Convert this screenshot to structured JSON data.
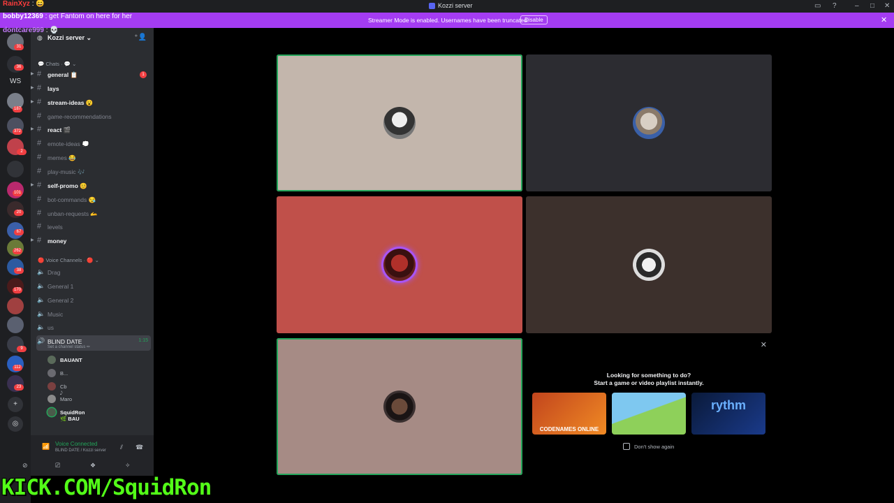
{
  "window": {
    "title": "Kozzi server"
  },
  "banner": {
    "message": "Streamer Mode is enabled. Usernames have been truncated.",
    "disable_label": "Disable"
  },
  "chat_overlay": [
    {
      "name": "RainXyz",
      "message": ": 😄",
      "color": "#ff3d3d"
    },
    {
      "name": "bobby12369",
      "message": ": get Fantom on here for her",
      "color": "#ffffff"
    },
    {
      "name": "dontcare999",
      "message": ": 💀",
      "color": "#c77dff"
    }
  ],
  "server": {
    "name": "Kozzi server"
  },
  "rail": {
    "ws_label": "WS",
    "badges": [
      "31",
      "36",
      "187",
      "372",
      "2",
      "101",
      "20",
      "67",
      "262",
      "38",
      "170",
      "9",
      "112",
      "23"
    ]
  },
  "categories": {
    "chats": "Chats",
    "voice": "Voice Channels"
  },
  "channels": [
    {
      "name": "general 📋",
      "unread": true,
      "arrow": true,
      "badge": "1"
    },
    {
      "name": "lays",
      "unread": true,
      "arrow": true
    },
    {
      "name": "stream-ideas 😮",
      "unread": true,
      "arrow": true
    },
    {
      "name": "game-recommendations",
      "unread": false
    },
    {
      "name": "react 🎬",
      "unread": true,
      "arrow": true
    },
    {
      "name": "emote-ideas 💭",
      "unread": false
    },
    {
      "name": "memes 😂",
      "unread": false
    },
    {
      "name": "play-music 🎶",
      "unread": false
    },
    {
      "name": "self-promo 😊",
      "unread": true,
      "arrow": true
    },
    {
      "name": "bot-commands 😪",
      "unread": false
    },
    {
      "name": "unban-requests 🫴",
      "unread": false
    },
    {
      "name": "levels",
      "unread": false
    },
    {
      "name": "money",
      "unread": true,
      "arrow": true
    }
  ],
  "voice_channels": [
    "Drag",
    "General 1",
    "General 2",
    "Music",
    "us"
  ],
  "active_voice": {
    "name": "BLIND DATE",
    "duration": "1:15",
    "status": "Set a channel status ✏"
  },
  "voice_users": [
    {
      "name": "BAUANT",
      "bold": true,
      "speaking": false
    },
    {
      "name": "B...",
      "bold": false,
      "speaking": false
    },
    {
      "name": "Cb 𝅘𝅥𝅮",
      "bold": false,
      "speaking": false
    },
    {
      "name": "Maro",
      "bold": false,
      "speaking": false
    },
    {
      "name": "SquidRon 🌿 BAU",
      "bold": true,
      "speaking": true
    }
  ],
  "voice_panel": {
    "status": "Voice Connected",
    "location": "BLIND DATE / Kozzi server"
  },
  "activity": {
    "line1": "Looking for something to do?",
    "line2": "Start a game or video playlist instantly.",
    "cards": [
      "CODENAMES ONLINE",
      "",
      "rythm"
    ],
    "dont_show": "Don't show again"
  },
  "watermark": "KICK.COM/SquidRon",
  "colors": {
    "speaking": "#23a55a",
    "banner": "#a43cf2",
    "accent": "#5865f2",
    "kick_green": "#53fc18"
  }
}
